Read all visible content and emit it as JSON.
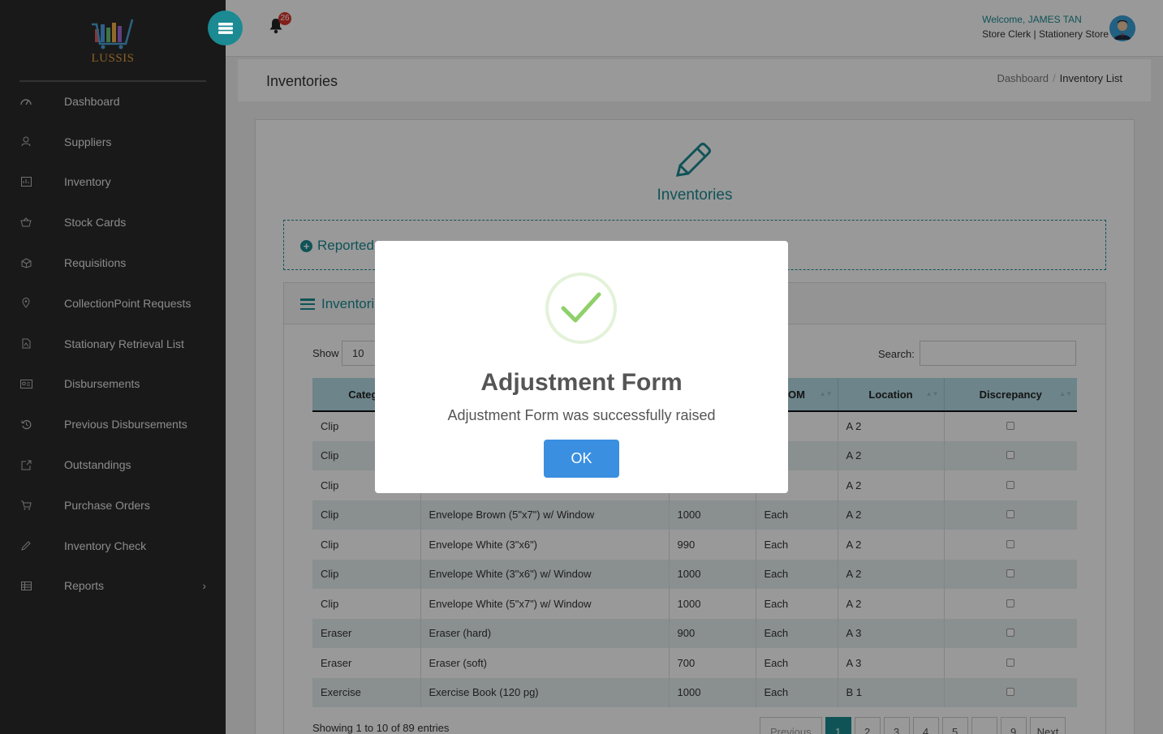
{
  "app": {
    "logo_text": "LUSSIS"
  },
  "sidebar": {
    "items": [
      {
        "label": "Dashboard",
        "icon": "dashboard-icon"
      },
      {
        "label": "Suppliers",
        "icon": "user-icon"
      },
      {
        "label": "Inventory",
        "icon": "inventory-icon"
      },
      {
        "label": "Stock Cards",
        "icon": "basket-icon"
      },
      {
        "label": "Requisitions",
        "icon": "cube-icon"
      },
      {
        "label": "CollectionPoint Requests",
        "icon": "map-pin-icon"
      },
      {
        "label": "Stationary Retrieval List",
        "icon": "file-icon"
      },
      {
        "label": "Disbursements",
        "icon": "id-card-icon"
      },
      {
        "label": "Previous Disbursements",
        "icon": "history-icon"
      },
      {
        "label": "Outstandings",
        "icon": "external-link-icon"
      },
      {
        "label": "Purchase Orders",
        "icon": "cart-icon"
      },
      {
        "label": "Inventory Check",
        "icon": "pencil-icon"
      },
      {
        "label": "Reports",
        "icon": "table-icon"
      }
    ],
    "reports_chevron": "›"
  },
  "topbar": {
    "notification_count": "26",
    "welcome": "Welcome, JAMES TAN",
    "role": "Store Clerk | Stationery Store"
  },
  "page": {
    "title": "Inventories",
    "breadcrumb": [
      "Dashboard",
      "Inventory List"
    ],
    "card_title": "Inventories",
    "reported_panel": "Reported",
    "inventory_panel": "Inventori"
  },
  "table": {
    "show_label": "Show",
    "show_value": "10",
    "search_label": "Search:",
    "headers": [
      "Catego",
      "",
      "",
      "OM",
      "Location",
      "Discrepancy"
    ],
    "rows": [
      [
        "Clip",
        "",
        "",
        "",
        "A 2"
      ],
      [
        "Clip",
        "",
        "",
        "",
        "A 2"
      ],
      [
        "Clip",
        "",
        "",
        "",
        "A 2"
      ],
      [
        "Clip",
        "Envelope Brown (5\"x7\") w/ Window",
        "1000",
        "Each",
        "A 2"
      ],
      [
        "Clip",
        "Envelope White (3\"x6\")",
        "990",
        "Each",
        "A 2"
      ],
      [
        "Clip",
        "Envelope White (3\"x6\") w/ Window",
        "1000",
        "Each",
        "A 2"
      ],
      [
        "Clip",
        "Envelope White (5\"x7\") w/ Window",
        "1000",
        "Each",
        "A 2"
      ],
      [
        "Eraser",
        "Eraser (hard)",
        "900",
        "Each",
        "A 3"
      ],
      [
        "Eraser",
        "Eraser (soft)",
        "700",
        "Each",
        "A 3"
      ],
      [
        "Exercise",
        "Exercise Book (120 pg)",
        "1000",
        "Each",
        "B 1"
      ]
    ],
    "info": "Showing 1 to 10 of 89 entries",
    "pagination": [
      "Previous",
      "1",
      "2",
      "3",
      "4",
      "5",
      "...",
      "9",
      "Next"
    ]
  },
  "modal": {
    "title": "Adjustment Form",
    "text": "Adjustment Form was successfully raised",
    "ok": "OK"
  },
  "colors": {
    "accent": "#1b8a92",
    "sidebar": "#2a2a2a",
    "ok_button": "#3a8fe0",
    "success": "#8fd06a"
  }
}
